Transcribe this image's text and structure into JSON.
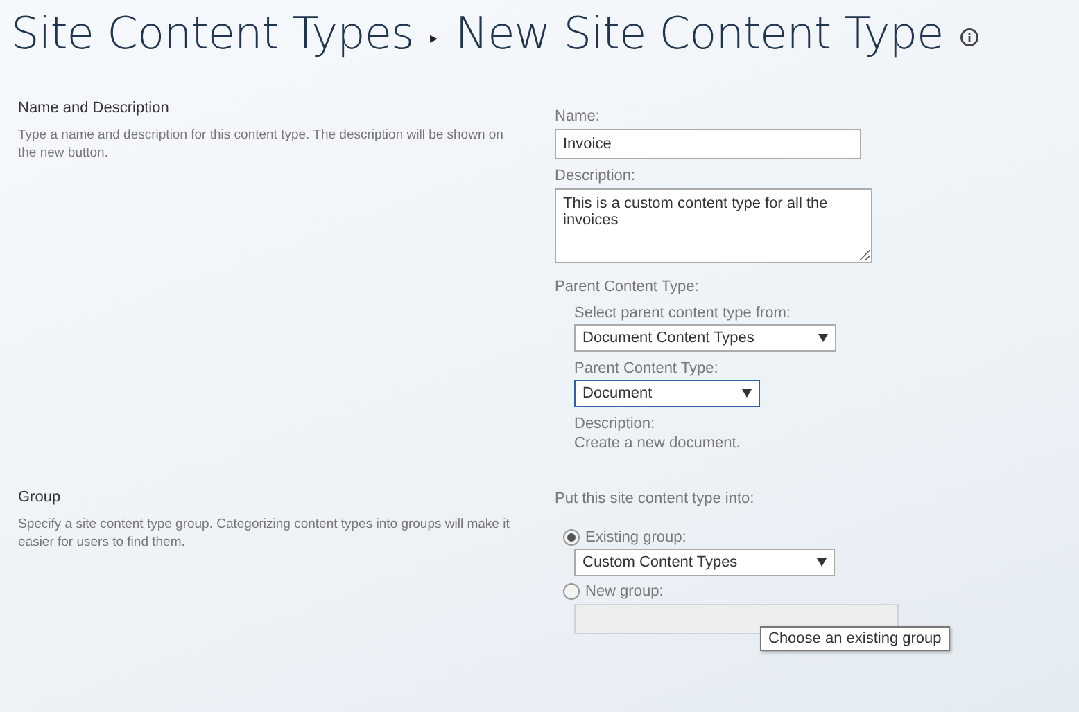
{
  "breadcrumb": {
    "parent": "Site Content Types",
    "separator": "▸",
    "current": "New Site Content Type"
  },
  "sections": [
    {
      "title": "Name and Description",
      "description": "Type a name and description for this content type. The description will be shown on the new button.",
      "kind": "name"
    },
    {
      "title": "Group",
      "description": "Specify a site content type group. Categorizing content types into groups will make it easier for users to find them.",
      "kind": "group"
    }
  ],
  "name_field": {
    "label": "Name:",
    "value": "Invoice"
  },
  "description_field": {
    "label": "Description:",
    "value": "This is a custom content type for all the invoices"
  },
  "parent_content_type": {
    "label": "Parent Content Type:",
    "select_from_label": "Select parent content type from:",
    "select_from_value": "Document Content Types",
    "type_label": "Parent Content Type:",
    "type_value": "Document",
    "description_label": "Description:",
    "description_text": "Create a new document."
  },
  "group": {
    "label": "Put this site content type into:",
    "options": [
      {
        "label": "Existing group:",
        "selected": true,
        "value": "Custom Content Types",
        "kind": "select"
      },
      {
        "label": "New group:",
        "selected": false,
        "kind": "text"
      }
    ]
  },
  "tooltip": "Choose an existing group"
}
